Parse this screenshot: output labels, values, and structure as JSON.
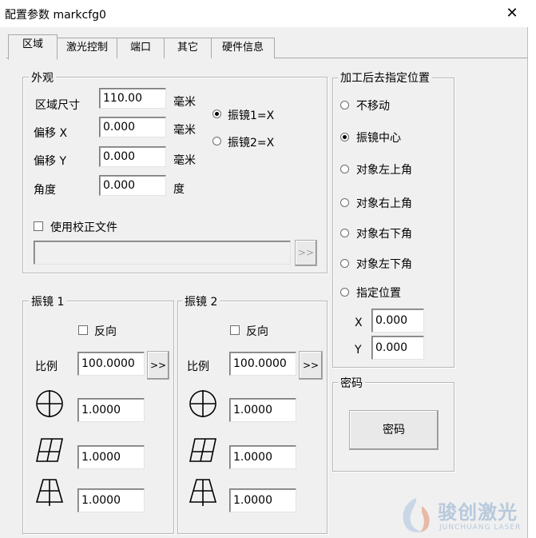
{
  "window": {
    "title": "配置参数 markcfg0",
    "close_glyph": "✕"
  },
  "tabs": [
    {
      "label": "区域",
      "active": true
    },
    {
      "label": "激光控制",
      "active": false
    },
    {
      "label": "端口",
      "active": false
    },
    {
      "label": "其它",
      "active": false
    },
    {
      "label": "硬件信息",
      "active": false
    }
  ],
  "appearance": {
    "title": "外观",
    "area_size": {
      "label": "区域尺寸",
      "value": "110.00",
      "unit": "毫米"
    },
    "offset_x": {
      "label": "偏移 X",
      "value": "0.000",
      "unit": "毫米"
    },
    "offset_y": {
      "label": "偏移 Y",
      "value": "0.000",
      "unit": "毫米"
    },
    "angle": {
      "label": "角度",
      "value": "0.000",
      "unit": "度"
    },
    "galvo1_x": {
      "label": "振镜1=X",
      "selected": true
    },
    "galvo2_x": {
      "label": "振镜2=X",
      "selected": false
    },
    "use_correction_file": {
      "label": "使用校正文件",
      "checked": false
    },
    "correction_path": "",
    "browse_label": ">>"
  },
  "go_position": {
    "title": "加工后去指定位置",
    "options": [
      {
        "label": "不移动",
        "selected": false
      },
      {
        "label": "振镜中心",
        "selected": true
      },
      {
        "label": "对象左上角",
        "selected": false
      },
      {
        "label": "对象右上角",
        "selected": false
      },
      {
        "label": "对象右下角",
        "selected": false
      },
      {
        "label": "对象左下角",
        "selected": false
      },
      {
        "label": "指定位置",
        "selected": false
      }
    ],
    "x": {
      "label": "X",
      "value": "0.000"
    },
    "y": {
      "label": "Y",
      "value": "0.000"
    }
  },
  "galvo1": {
    "title": "振镜 1",
    "reverse": {
      "label": "反向",
      "checked": false
    },
    "scale": {
      "label": "比例",
      "value": "100.0000",
      "button": ">>"
    },
    "barrel": "1.0000",
    "parallelogram": "1.0000",
    "trapezoid": "1.0000"
  },
  "galvo2": {
    "title": "振镜 2",
    "reverse": {
      "label": "反向",
      "checked": false
    },
    "scale": {
      "label": "比例",
      "value": "100.0000",
      "button": ">>"
    },
    "barrel": "1.0000",
    "parallelogram": "1.0000",
    "trapezoid": "1.0000"
  },
  "password": {
    "title": "密码",
    "button": "密码"
  },
  "watermark": {
    "cn": "骏创激光",
    "en": "JUNCHUANG LASER"
  },
  "colors": {
    "face": "#f0f0f0",
    "border": "#b8b8b8",
    "watermark": "#b7c9dc"
  }
}
